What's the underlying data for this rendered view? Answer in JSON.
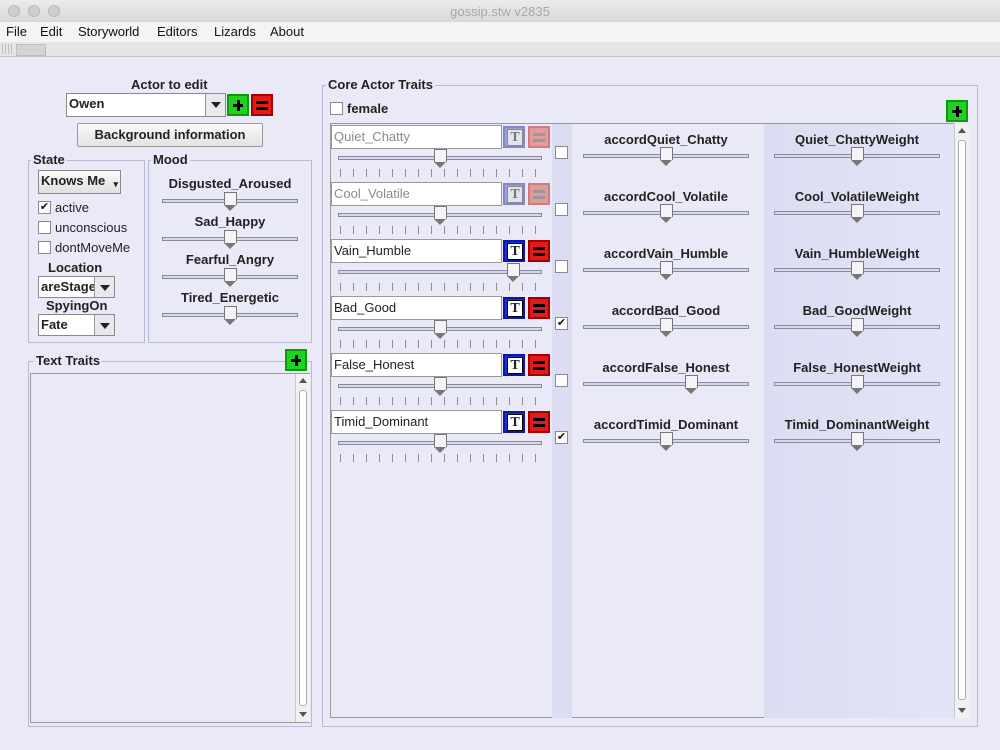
{
  "window": {
    "title": "gossip.stw v2835"
  },
  "menu": [
    "File",
    "Edit",
    "Storyworld",
    "Editors",
    "Lizards",
    "About"
  ],
  "actor": {
    "label": "Actor to edit",
    "value": "Owen",
    "background_button": "Background information"
  },
  "state": {
    "title": "State",
    "dropdown": "Knows Me",
    "checks": [
      {
        "label": "active",
        "checked": true
      },
      {
        "label": "unconscious",
        "checked": false
      },
      {
        "label": "dontMoveMe",
        "checked": false
      }
    ],
    "location": {
      "label": "Location",
      "value": "areStage"
    },
    "spying": {
      "label": "SpyingOn",
      "value": "Fate"
    }
  },
  "mood": {
    "title": "Mood",
    "sliders": [
      {
        "label": "Disgusted_Aroused",
        "value": 0.5
      },
      {
        "label": "Sad_Happy",
        "value": 0.5
      },
      {
        "label": "Fearful_Angry",
        "value": 0.5
      },
      {
        "label": "Tired_Energetic",
        "value": 0.5
      }
    ]
  },
  "text_traits": {
    "title": "Text Traits"
  },
  "core": {
    "title": "Core Actor Traits",
    "female_label": "female",
    "female_checked": false,
    "traits": [
      {
        "name": "Quiet_Chatty",
        "enabled": false,
        "value": 0.5,
        "checked": false,
        "accord_label": "accordQuiet_Chatty",
        "accord_value": 0.5,
        "weight_label": "Quiet_ChattyWeight",
        "weight_value": 0.5
      },
      {
        "name": "Cool_Volatile",
        "enabled": false,
        "value": 0.5,
        "checked": false,
        "accord_label": "accordCool_Volatile",
        "accord_value": 0.5,
        "weight_label": "Cool_VolatileWeight",
        "weight_value": 0.5
      },
      {
        "name": "Vain_Humble",
        "enabled": true,
        "value": 0.88,
        "checked": false,
        "accord_label": "accordVain_Humble",
        "accord_value": 0.5,
        "weight_label": "Vain_HumbleWeight",
        "weight_value": 0.5
      },
      {
        "name": "Bad_Good",
        "enabled": true,
        "value": 0.5,
        "checked": true,
        "accord_label": "accordBad_Good",
        "accord_value": 0.5,
        "weight_label": "Bad_GoodWeight",
        "weight_value": 0.5
      },
      {
        "name": "False_Honest",
        "enabled": true,
        "value": 0.5,
        "checked": false,
        "accord_label": "accordFalse_Honest",
        "accord_value": 0.66,
        "weight_label": "False_HonestWeight",
        "weight_value": 0.5
      },
      {
        "name": "Timid_Dominant",
        "enabled": true,
        "value": 0.5,
        "checked": true,
        "accord_label": "accordTimid_Dominant",
        "accord_value": 0.5,
        "weight_label": "Timid_DominantWeight",
        "weight_value": 0.5
      }
    ]
  }
}
